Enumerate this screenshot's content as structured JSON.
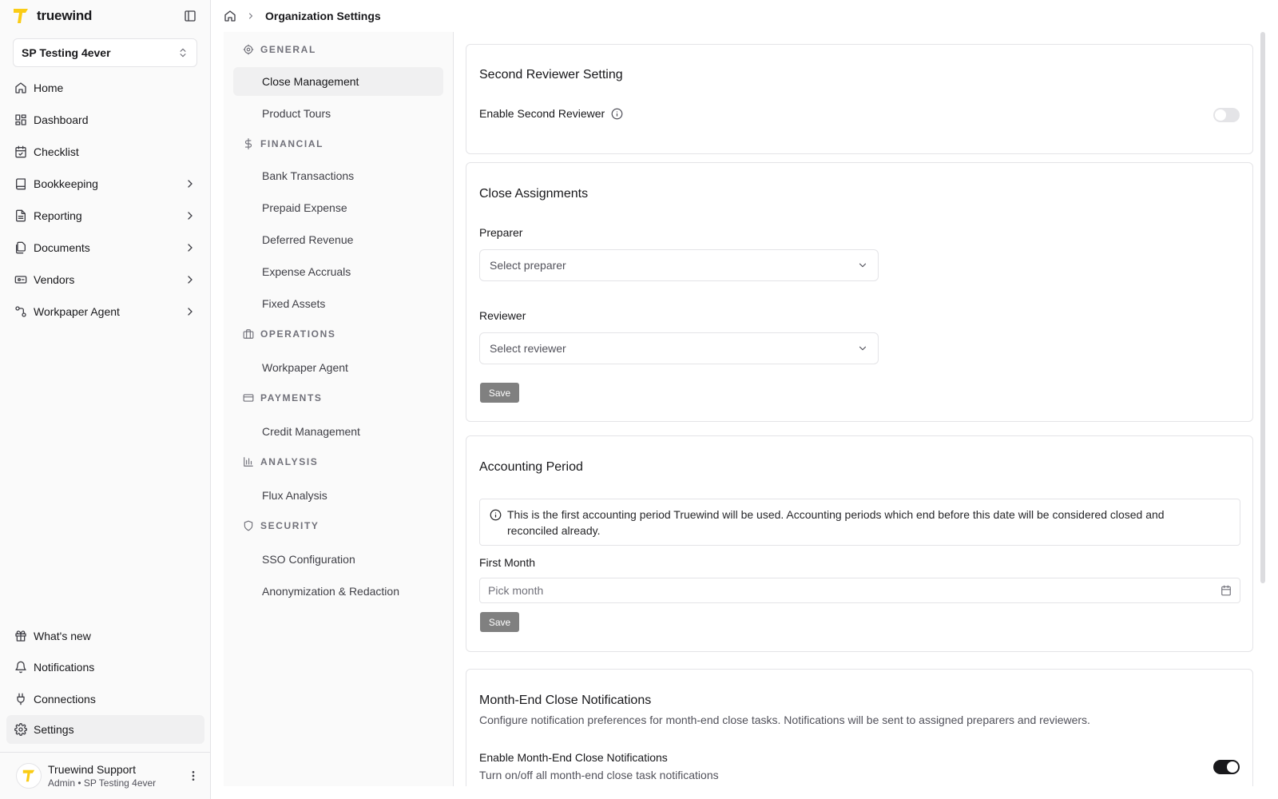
{
  "app": {
    "name": "truewind"
  },
  "org_selector": {
    "value": "SP Testing 4ever"
  },
  "nav": [
    {
      "label": "Home",
      "icon": "home-icon",
      "chevron": false
    },
    {
      "label": "Dashboard",
      "icon": "dashboard-icon",
      "chevron": false
    },
    {
      "label": "Checklist",
      "icon": "calendar-check-icon",
      "chevron": false
    },
    {
      "label": "Bookkeeping",
      "icon": "book-icon",
      "chevron": true
    },
    {
      "label": "Reporting",
      "icon": "file-text-icon",
      "chevron": true
    },
    {
      "label": "Documents",
      "icon": "files-icon",
      "chevron": true
    },
    {
      "label": "Vendors",
      "icon": "vendor-icon",
      "chevron": true
    },
    {
      "label": "Workpaper Agent",
      "icon": "workflow-icon",
      "chevron": true
    }
  ],
  "nav_bottom": [
    {
      "label": "What's new",
      "icon": "gift-icon"
    },
    {
      "label": "Notifications",
      "icon": "bell-icon"
    },
    {
      "label": "Connections",
      "icon": "plug-icon"
    },
    {
      "label": "Settings",
      "icon": "gear-icon"
    }
  ],
  "user": {
    "name": "Truewind Support",
    "role": "Admin • SP Testing 4ever"
  },
  "breadcrumb": {
    "title": "Organization Settings"
  },
  "settings_nav": [
    {
      "section": "GENERAL",
      "icon": "gear-icon",
      "items": [
        "Close Management",
        "Product Tours"
      ]
    },
    {
      "section": "FINANCIAL",
      "icon": "dollar-icon",
      "items": [
        "Bank Transactions",
        "Prepaid Expense",
        "Deferred Revenue",
        "Expense Accruals",
        "Fixed Assets"
      ]
    },
    {
      "section": "OPERATIONS",
      "icon": "briefcase-icon",
      "items": [
        "Workpaper Agent"
      ]
    },
    {
      "section": "PAYMENTS",
      "icon": "credit-card-icon",
      "items": [
        "Credit Management"
      ]
    },
    {
      "section": "ANALYSIS",
      "icon": "bar-chart-icon",
      "items": [
        "Flux Analysis"
      ]
    },
    {
      "section": "SECURITY",
      "icon": "shield-icon",
      "items": [
        "SSO Configuration",
        "Anonymization & Redaction"
      ]
    }
  ],
  "second_reviewer": {
    "title": "Second Reviewer Setting",
    "toggle_label": "Enable Second Reviewer",
    "enabled": false
  },
  "close_assignments": {
    "title": "Close Assignments",
    "preparer_label": "Preparer",
    "preparer_placeholder": "Select preparer",
    "reviewer_label": "Reviewer",
    "reviewer_placeholder": "Select reviewer",
    "save_label": "Save"
  },
  "accounting_period": {
    "title": "Accounting Period",
    "info_line1": "This is the first accounting period Truewind will be used. Accounting periods which end before this date will be considered closed and",
    "info_line2": "reconciled already.",
    "first_month_label": "First Month",
    "first_month_placeholder": "Pick month",
    "save_label": "Save"
  },
  "month_end": {
    "title": "Month-End Close Notifications",
    "description": "Configure notification preferences for month-end close tasks. Notifications will be sent to assigned preparers and reviewers.",
    "toggle_label": "Enable Month-End Close Notifications",
    "toggle_desc": "Turn on/off all month-end close task notifications",
    "enabled": true
  },
  "colors": {
    "accent": "#facc15",
    "toggle_on": "#18181b",
    "save_button": "#808080"
  }
}
